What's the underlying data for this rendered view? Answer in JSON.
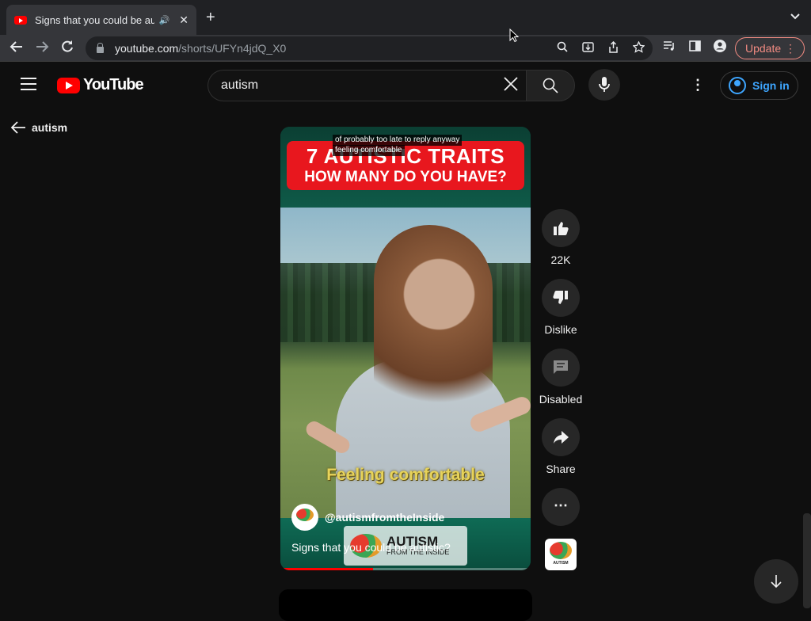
{
  "browser": {
    "tab_title": "Signs that you could be autistic?",
    "tab_audio": "🔊",
    "tab_close": "✕",
    "new_tab": "+",
    "url_host": "youtube.com",
    "url_path": "/shorts/UFYn4jdQ_X0",
    "update_label": "Update"
  },
  "header": {
    "logo_text": "YouTube",
    "search_value": "autism",
    "signin_label": "Sign in"
  },
  "back": {
    "label": "autism"
  },
  "video": {
    "banner_line1": "7 AUTISTIC TRAITS",
    "banner_line2": "HOW MANY DO YOU HAVE?",
    "caption_line1": "of probably too late to reply anyway",
    "caption_line2": "feeling comfortable",
    "overlay_text": "Feeling comfortable",
    "watermark_title": "AUTISM",
    "watermark_sub": "FROM THE INSIDE",
    "channel": "@autismfromtheInside",
    "title": "Signs that you could be autistic?",
    "progress": 0.37
  },
  "actions": {
    "like_count": "22K",
    "dislike_label": "Dislike",
    "comments_label": "Disabled",
    "share_label": "Share",
    "more_label": "⋯",
    "thumb_text": "AUTISM"
  },
  "colors": {
    "accent_red": "#ff0000",
    "link_blue": "#3ea6ff",
    "banner_red": "#e8171e",
    "overlay_yellow": "#e7d35a"
  }
}
